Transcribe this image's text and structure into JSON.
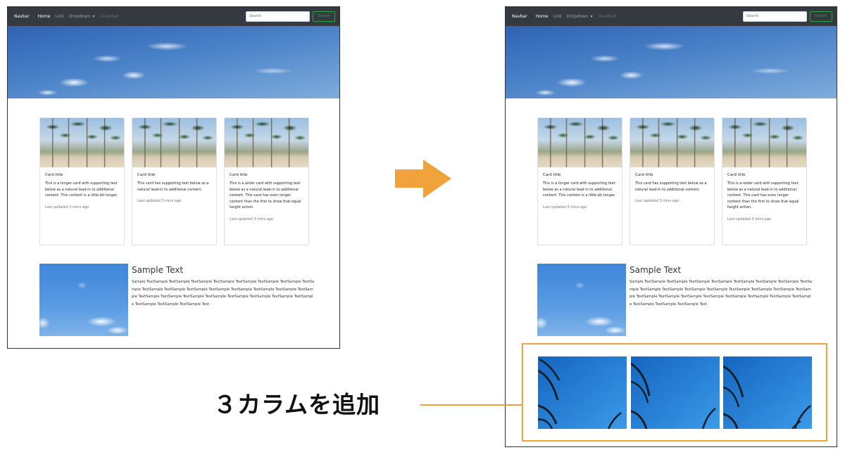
{
  "navbar": {
    "brand": "Navbar",
    "links": [
      "Home",
      "Link",
      "Dropdown",
      "Disabled"
    ],
    "search_placeholder": "Search",
    "search_button": "Search"
  },
  "cards": [
    {
      "title": "Card title",
      "text": "This is a longer card with supporting text below as a natural lead-in to additional content. This content is a little bit longer.",
      "updated": "Last updated 3 mins ago"
    },
    {
      "title": "Card title",
      "text": "This card has supporting text below as a natural lead-in to additional content.",
      "updated": "Last updated 3 mins ago"
    },
    {
      "title": "Card title",
      "text": "This is a wider card with supporting text below as a natural lead-in to additional content. This card has even longer content than the first to show that equal height action.",
      "updated": "Last updated 3 mins ago"
    }
  ],
  "media": {
    "title": "Sample Text",
    "text": "Sample TextSample TextSample TextSample TextSample TextSample TextSample TextSample TextSample TextSample TextSample TextSample TextSample TextSample TextSample TextSample TextSample TextSample TextSample TextSample TextSample TextSample TextSample TextSample TextSample TextSample TextSample TextSample Text"
  },
  "annotation": {
    "label": "３カラムを追加",
    "highlight_color": "#f0a33a",
    "arrow_color": "#f0a33a"
  },
  "colors": {
    "navbar_bg": "#343a40",
    "search_button": "#28a745"
  }
}
